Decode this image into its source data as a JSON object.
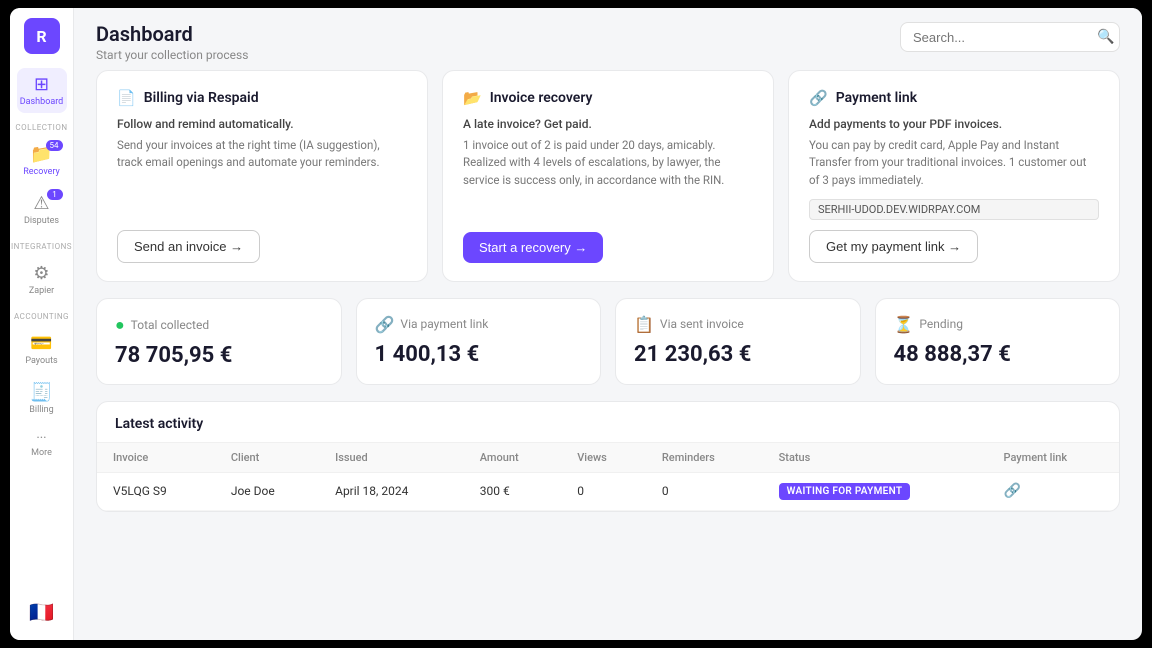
{
  "app": {
    "logo": "R"
  },
  "sidebar": {
    "section_collection": "COLLECTION",
    "section_integrations": "INTEGRATIONS",
    "section_accounting": "ACCOUNTING",
    "items": [
      {
        "id": "dashboard",
        "label": "Dashboard",
        "icon": "⊞",
        "active": true,
        "badge": null
      },
      {
        "id": "recovery",
        "label": "Recovery",
        "icon": "📁",
        "active": false,
        "badge": "54"
      },
      {
        "id": "disputes",
        "label": "Disputes",
        "icon": "⚠",
        "active": false,
        "badge": "1"
      },
      {
        "id": "zapier",
        "label": "Zapier",
        "icon": "⚙",
        "active": false,
        "badge": null
      },
      {
        "id": "payouts",
        "label": "Payouts",
        "icon": "💳",
        "active": false,
        "badge": null
      },
      {
        "id": "billing",
        "label": "Billing",
        "icon": "🧾",
        "active": false,
        "badge": null
      },
      {
        "id": "more",
        "label": "More",
        "icon": "···",
        "active": false,
        "badge": null
      }
    ],
    "flag": "🇫🇷"
  },
  "header": {
    "title": "Dashboard",
    "subtitle": "Start your collection process",
    "search_placeholder": "Search..."
  },
  "cards": [
    {
      "id": "billing",
      "icon": "📄",
      "title": "Billing via Respaid",
      "desc": "Follow and remind automatically.",
      "body": "Send your invoices at the right time (IA suggestion), track email openings and automate your reminders.",
      "button_label": "Send an invoice →",
      "button_primary": false
    },
    {
      "id": "recovery",
      "icon": "📂",
      "title": "Invoice recovery",
      "desc": "A late invoice? Get paid.",
      "body": "1 invoice out of 2 is paid under 20 days, amicably. Realized with 4 levels of escalations, by lawyer, the service is success only, in accordance with the RIN.",
      "button_label": "Start a recovery →",
      "button_primary": true
    },
    {
      "id": "payment-link",
      "icon": "🔗",
      "title": "Payment link",
      "desc": "Add payments to your PDF invoices.",
      "body": "You can pay by credit card, Apple Pay and Instant Transfer from your traditional invoices. 1 customer out of 3 pays immediately.",
      "domain": "SERHII-UDOD.DEV.WIDRPAY.COM",
      "button_label": "Get my payment link →",
      "button_primary": false
    }
  ],
  "stats": [
    {
      "id": "total-collected",
      "icon": "💚",
      "icon_type": "green",
      "label": "Total collected",
      "value": "78 705,95 €"
    },
    {
      "id": "via-payment-link",
      "icon": "🔗",
      "icon_type": "purple",
      "label": "Via payment link",
      "value": "1 400,13 €"
    },
    {
      "id": "via-sent-invoice",
      "icon": "📋",
      "icon_type": "blue",
      "label": "Via sent invoice",
      "value": "21 230,63 €"
    },
    {
      "id": "pending",
      "icon": "⏳",
      "icon_type": "gray",
      "label": "Pending",
      "value": "48 888,37 €"
    }
  ],
  "activity": {
    "title": "Latest activity",
    "columns": [
      "Invoice",
      "Client",
      "Issued",
      "Amount",
      "Views",
      "Reminders",
      "Status",
      "Payment link"
    ],
    "rows": [
      {
        "invoice": "V5LQG S9",
        "client": "Joe Doe",
        "issued": "April 18, 2024",
        "amount": "300 €",
        "views": "0",
        "reminders": "0",
        "status": "WAITING FOR PAYMENT",
        "payment_link": "🔗"
      }
    ]
  }
}
